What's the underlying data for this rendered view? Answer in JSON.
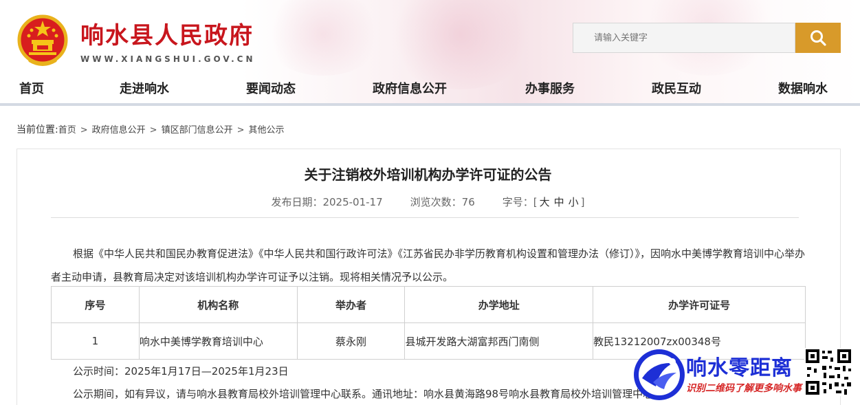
{
  "header": {
    "site_title": "响水县人民政府",
    "site_domain": "WWW.XIANGSHUI.GOV.CN"
  },
  "search": {
    "placeholder": "请输入关键字"
  },
  "nav": {
    "items": [
      "首页",
      "走进响水",
      "要闻动态",
      "政府信息公开",
      "办事服务",
      "政民互动",
      "数据响水"
    ]
  },
  "breadcrumb": {
    "lead": "当前位置:",
    "items": [
      "首页",
      "政府信息公开",
      "镇区部门信息公开",
      "其他公示"
    ],
    "separator": ">"
  },
  "article": {
    "title": "关于注销校外培训机构办学许可证的公告",
    "publish_date": "发布日期：2025-01-17",
    "views": "浏览次数：76",
    "font_size_label": "字号：[",
    "font_size_close": "]",
    "font_sizes": [
      "大",
      "中",
      "小"
    ],
    "paragraph": "根据《中华人民共和国民办教育促进法》《中华人民共和国行政许可法》《江苏省民办非学历教育机构设置和管理办法（修订）》，因响水中美博学教育培训中心举办者主动申请，县教育局决定对该培训机构办学许可证予以注销。现将相关情况予以公示。",
    "table": {
      "headers": [
        "序号",
        "机构名称",
        "举办者",
        "办学地址",
        "办学许可证号"
      ],
      "rows": [
        [
          "1",
          "响水中美博学教育培训中心",
          "蔡永刚",
          "县城开发路大湖富邦西门南侧",
          "教民13212007zx00348号"
        ]
      ]
    },
    "notice_time": "公示时间：2025年1月17日—2025年1月23日",
    "notice_contact": "公示期间，如有异议，请与响水县教育局校外培训管理中心联系。通讯地址：响水县黄海路98号响水县教育局校外培训管理中心。"
  },
  "watermark": {
    "name": "响水零距离",
    "subtitle": "识别二维码了解更多响水事"
  },
  "colors": {
    "brand_red": "#c8161d",
    "search_button": "#d89a2a",
    "watermark_blue": "#1d2fd6",
    "watermark_red": "#d62828"
  }
}
